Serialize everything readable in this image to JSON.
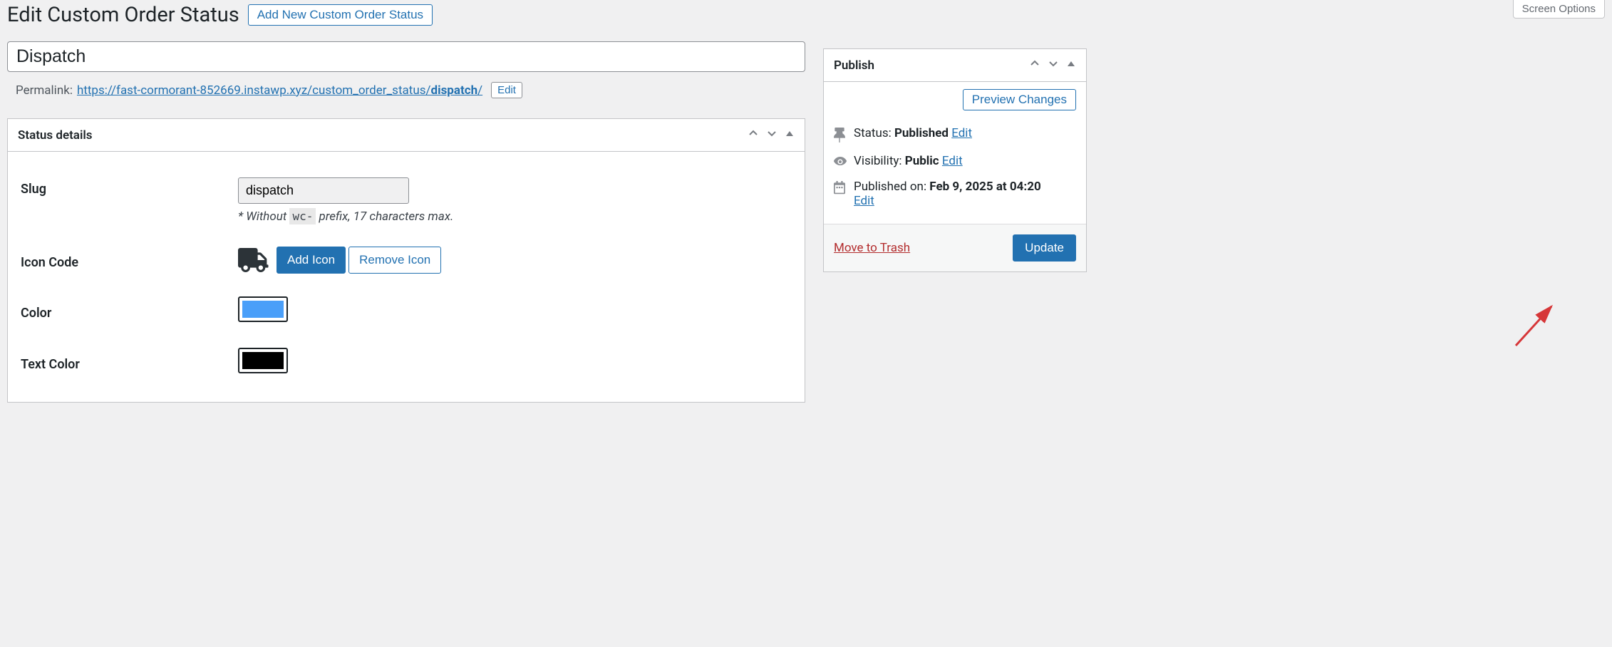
{
  "screen_options": "Screen Options",
  "page_title": "Edit Custom Order Status",
  "add_new_btn": "Add New Custom Order Status",
  "title_value": "Dispatch",
  "permalink": {
    "label": "Permalink:",
    "base": "https://fast-cormorant-852669.instawp.xyz/custom_order_status/",
    "slug": "dispatch",
    "trail": "/",
    "edit": "Edit"
  },
  "status_details": {
    "panel_title": "Status details",
    "slug_label": "Slug",
    "slug_value": "dispatch",
    "slug_hint_pre": "* Without ",
    "slug_hint_code": "wc-",
    "slug_hint_post": " prefix, 17 characters max.",
    "icon_label": "Icon Code",
    "add_icon": "Add Icon",
    "remove_icon": "Remove Icon",
    "color_label": "Color",
    "color_value": "#4a9ff9",
    "text_color_label": "Text Color",
    "text_color_value": "#000000"
  },
  "publish": {
    "panel_title": "Publish",
    "preview": "Preview Changes",
    "status_label": "Status: ",
    "status_value": "Published",
    "edit": "Edit",
    "visibility_label": "Visibility: ",
    "visibility_value": "Public",
    "published_label": "Published on: ",
    "published_value": "Feb 9, 2025 at 04:20",
    "trash": "Move to Trash",
    "update": "Update"
  }
}
